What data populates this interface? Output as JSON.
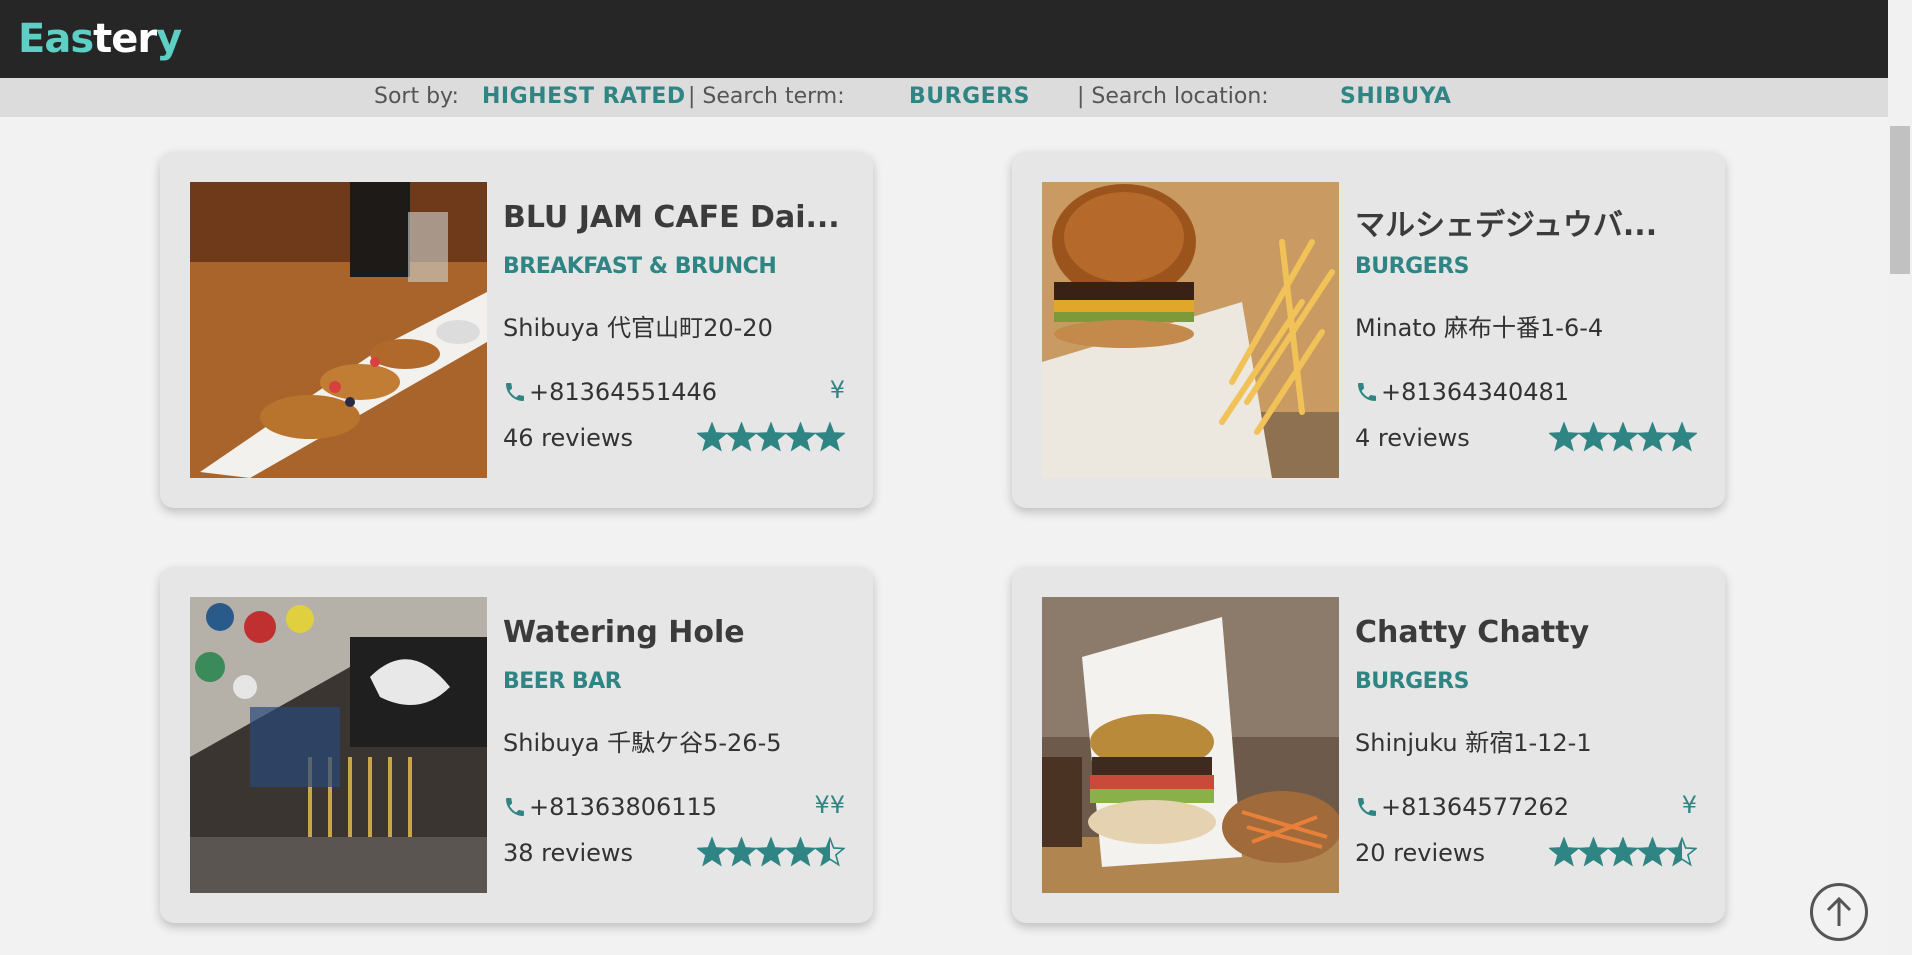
{
  "logo": {
    "part1": "Eas",
    "part2": "ter",
    "part3": "y"
  },
  "sortbar": {
    "sort_label": "Sort by:",
    "sort_value": "HIGHEST RATED",
    "term_label": "| Search term:",
    "term_value": "BURGERS",
    "location_label": "| Search location:",
    "location_value": "SHIBUYA"
  },
  "restaurants": [
    {
      "name": "BLU JAM CAFE Dai...",
      "category": "BREAKFAST & BRUNCH",
      "address": "Shibuya 代官山町20-20",
      "phone": "+81364551446",
      "price": "¥",
      "reviews": "46 reviews",
      "rating": 5
    },
    {
      "name": "マルシェデジュウバ...",
      "category": "BURGERS",
      "address": "Minato 麻布十番1-6-4",
      "phone": "+81364340481",
      "price": "",
      "reviews": "4 reviews",
      "rating": 5
    },
    {
      "name": "Watering Hole",
      "category": "BEER BAR",
      "address": "Shibuya 千駄ケ谷5-26-5",
      "phone": "+81363806115",
      "price": "¥¥",
      "reviews": "38 reviews",
      "rating": 4.5
    },
    {
      "name": "Chatty Chatty",
      "category": "BURGERS",
      "address": "Shinjuku 新宿1-12-1",
      "phone": "+81364577262",
      "price": "¥",
      "reviews": "20 reviews",
      "rating": 4.5
    }
  ],
  "icons": {
    "phone": "phone-icon",
    "star": "star-icon",
    "back_to_top": "arrow-up-circle-icon"
  },
  "colors": {
    "accent": "#2f8583",
    "logo_accent": "#5ecfc4",
    "header_bg": "#262626"
  }
}
